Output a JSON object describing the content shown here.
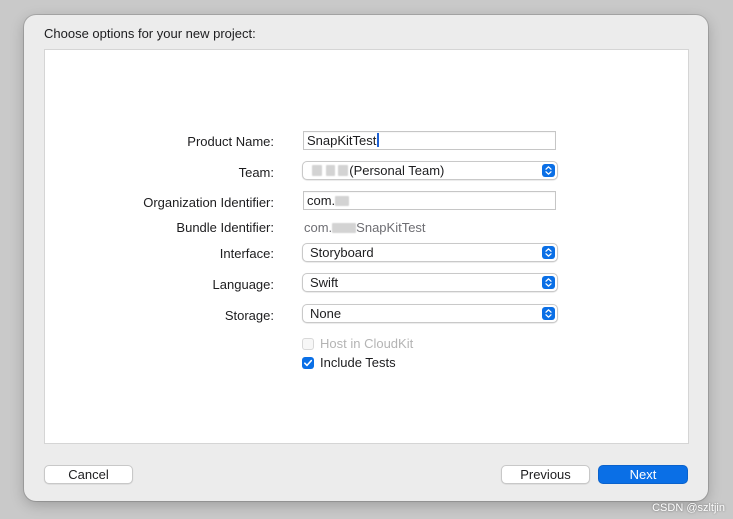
{
  "heading": "Choose options for your new project:",
  "fields": {
    "product_name": {
      "label": "Product Name:",
      "value": "SnapKitTest"
    },
    "team": {
      "label": "Team:",
      "value": "(Personal Team)"
    },
    "org_identifier": {
      "label": "Organization Identifier:",
      "value": "com."
    },
    "bundle_identifier": {
      "label": "Bundle Identifier:",
      "prefix": "com.",
      "suffix": "SnapKitTest"
    },
    "interface": {
      "label": "Interface:",
      "value": "Storyboard"
    },
    "language": {
      "label": "Language:",
      "value": "Swift"
    },
    "storage": {
      "label": "Storage:",
      "value": "None"
    }
  },
  "checkboxes": {
    "host_in_cloudkit": {
      "label": "Host in CloudKit",
      "checked": false,
      "enabled": false
    },
    "include_tests": {
      "label": "Include Tests",
      "checked": true,
      "enabled": true
    }
  },
  "buttons": {
    "cancel": "Cancel",
    "previous": "Previous",
    "next": "Next"
  },
  "watermark": "CSDN @szltjin",
  "colors": {
    "accent": "#0a6fe6",
    "sheet": "#ececec",
    "backdrop": "#c9c9c9"
  }
}
